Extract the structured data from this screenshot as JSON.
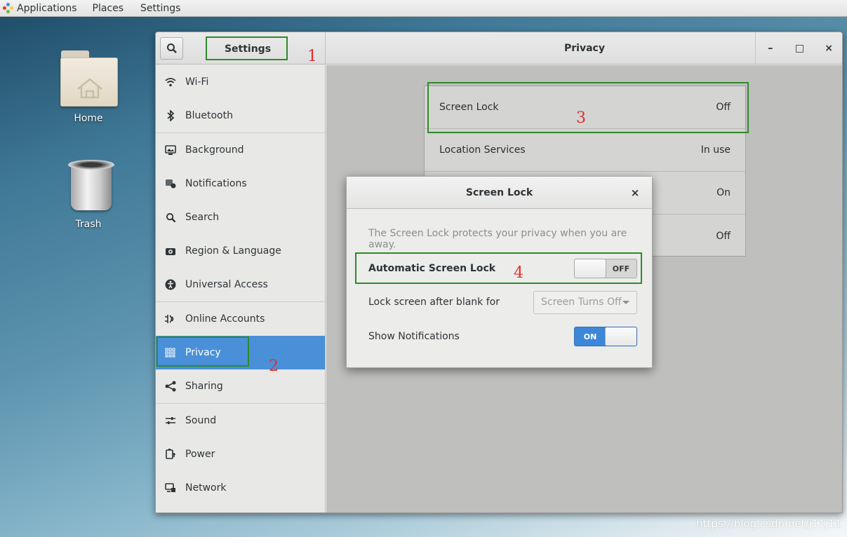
{
  "top_panel": {
    "menus": [
      "Applications",
      "Places",
      "Settings"
    ]
  },
  "desktop": {
    "icons": [
      {
        "label": "Home",
        "icon": "home-folder-icon"
      },
      {
        "label": "Trash",
        "icon": "trash-icon"
      }
    ]
  },
  "settings_window": {
    "left_title": "Settings",
    "right_title": "Privacy",
    "controls": {
      "minimize": "–",
      "maximize": "□",
      "close": "×"
    },
    "sidebar": [
      {
        "label": "Wi-Fi",
        "icon": "wifi-icon"
      },
      {
        "label": "Bluetooth",
        "icon": "bluetooth-icon"
      },
      {
        "label": "Background",
        "icon": "background-icon"
      },
      {
        "label": "Notifications",
        "icon": "notifications-icon"
      },
      {
        "label": "Search",
        "icon": "search-icon"
      },
      {
        "label": "Region & Language",
        "icon": "region-icon"
      },
      {
        "label": "Universal Access",
        "icon": "universal-access-icon"
      },
      {
        "label": "Online Accounts",
        "icon": "online-accounts-icon"
      },
      {
        "label": "Privacy",
        "icon": "privacy-icon",
        "selected": true
      },
      {
        "label": "Sharing",
        "icon": "sharing-icon"
      },
      {
        "label": "Sound",
        "icon": "sound-icon"
      },
      {
        "label": "Power",
        "icon": "power-icon"
      },
      {
        "label": "Network",
        "icon": "network-icon"
      }
    ],
    "privacy_rows": [
      {
        "label": "Screen Lock",
        "value": "Off"
      },
      {
        "label": "Location Services",
        "value": "In use"
      },
      {
        "label": "",
        "value": "On"
      },
      {
        "label": "",
        "value": "Off"
      }
    ]
  },
  "dialog": {
    "title": "Screen Lock",
    "close": "×",
    "description": "The Screen Lock protects your privacy when you are away.",
    "auto_lock": {
      "label": "Automatic Screen Lock",
      "state": "OFF"
    },
    "lock_after": {
      "label": "Lock screen after blank for",
      "value": "Screen Turns Off"
    },
    "show_notifications": {
      "label": "Show Notifications",
      "state": "ON"
    }
  },
  "annotations": [
    "1",
    "2",
    "3",
    "4"
  ],
  "watermark": "https://blog.csdn.net/j11j11",
  "colors": {
    "accent": "#4a90d9",
    "annotation_box": "#2f8a2a",
    "annotation_number": "#e0302c"
  }
}
